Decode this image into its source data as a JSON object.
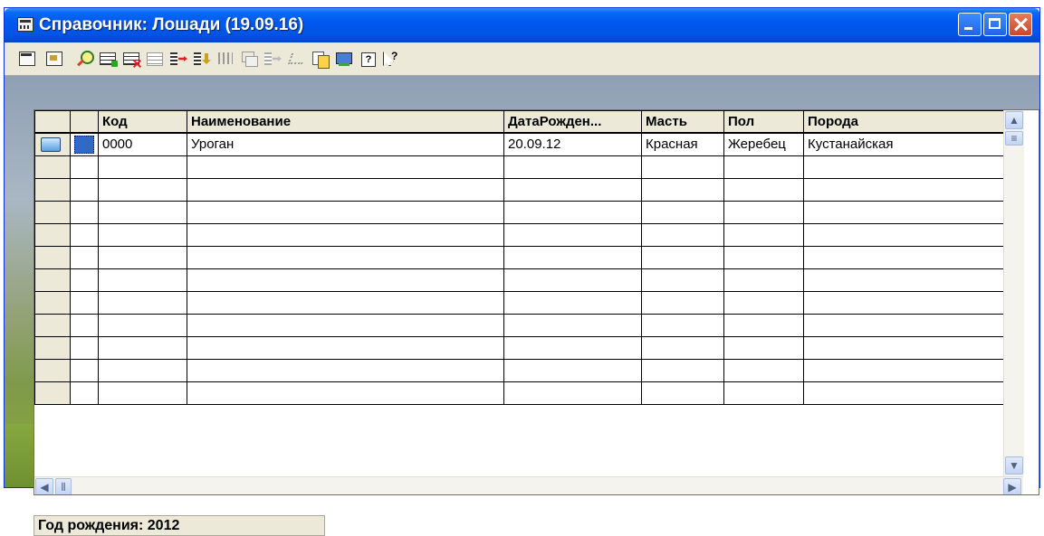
{
  "window": {
    "title": "Справочник: Лошади (19.09.16)"
  },
  "toolbar": {
    "icons": [
      "new-item-icon",
      "new-group-icon",
      "find-icon",
      "add-row-icon",
      "delete-row-icon",
      "copy-row-icon",
      "move-icon",
      "sort-icon",
      "filter-icon",
      "group-icon",
      "hierarchy-icon",
      "select-icon",
      "copy-icon",
      "print-icon",
      "help-icon",
      "whats-this-icon"
    ]
  },
  "grid": {
    "columns": [
      "Код",
      "Наименование",
      "ДатаРожден...",
      "Масть",
      "Пол",
      "Порода"
    ],
    "rows": [
      {
        "code": "0000",
        "name": "Уроган",
        "birth": "20.09.12",
        "color": "Красная",
        "sex": "Жеребец",
        "breed": "Кустанайская"
      }
    ],
    "empty_rows": 11
  },
  "status": {
    "text": "Год рождения: 2012"
  },
  "colors": {
    "titlebar": "#0058ee",
    "selection": "#316ac5",
    "panel": "#ece9d8"
  }
}
